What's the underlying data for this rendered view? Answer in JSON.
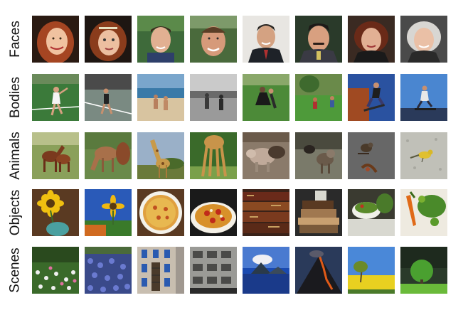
{
  "rows": [
    {
      "label": "Faces",
      "images": [
        {
          "name": "face-red-hair-woman"
        },
        {
          "name": "face-woman-tiara"
        },
        {
          "name": "face-young-man"
        },
        {
          "name": "face-man-outdoors"
        },
        {
          "name": "face-man-suit-smiling"
        },
        {
          "name": "face-man-mustache"
        },
        {
          "name": "face-woman-auburn"
        },
        {
          "name": "face-older-woman"
        }
      ]
    },
    {
      "label": "Bodies",
      "images": [
        {
          "name": "body-tennis-player"
        },
        {
          "name": "body-tennis-court"
        },
        {
          "name": "body-beach-people"
        },
        {
          "name": "body-beach-grayscale"
        },
        {
          "name": "body-dancers-grass"
        },
        {
          "name": "body-people-field"
        },
        {
          "name": "body-skateboard-jump"
        },
        {
          "name": "body-skater-sky"
        }
      ]
    },
    {
      "label": "Animals",
      "images": [
        {
          "name": "animal-horses-brown"
        },
        {
          "name": "animal-horse-grazing"
        },
        {
          "name": "animal-giraffe-trees"
        },
        {
          "name": "animal-giraffe-legs"
        },
        {
          "name": "animal-cows"
        },
        {
          "name": "animal-dogs"
        },
        {
          "name": "animal-bird-branch"
        },
        {
          "name": "animal-yellow-bird"
        }
      ]
    },
    {
      "label": "Objects",
      "images": [
        {
          "name": "object-sunflower-vase"
        },
        {
          "name": "object-sunflower-sky"
        },
        {
          "name": "object-pizza-plate"
        },
        {
          "name": "object-pizza-board"
        },
        {
          "name": "object-old-books"
        },
        {
          "name": "object-book-stack"
        },
        {
          "name": "object-salad-bowl"
        },
        {
          "name": "object-vegetables"
        }
      ]
    },
    {
      "label": "Scenes",
      "images": [
        {
          "name": "scene-flower-garden"
        },
        {
          "name": "scene-bluebonnets"
        },
        {
          "name": "scene-building-facade"
        },
        {
          "name": "scene-building-windows"
        },
        {
          "name": "scene-volcano-lake"
        },
        {
          "name": "scene-volcano-night"
        },
        {
          "name": "scene-yellow-field"
        },
        {
          "name": "scene-tree-hill"
        }
      ]
    }
  ]
}
